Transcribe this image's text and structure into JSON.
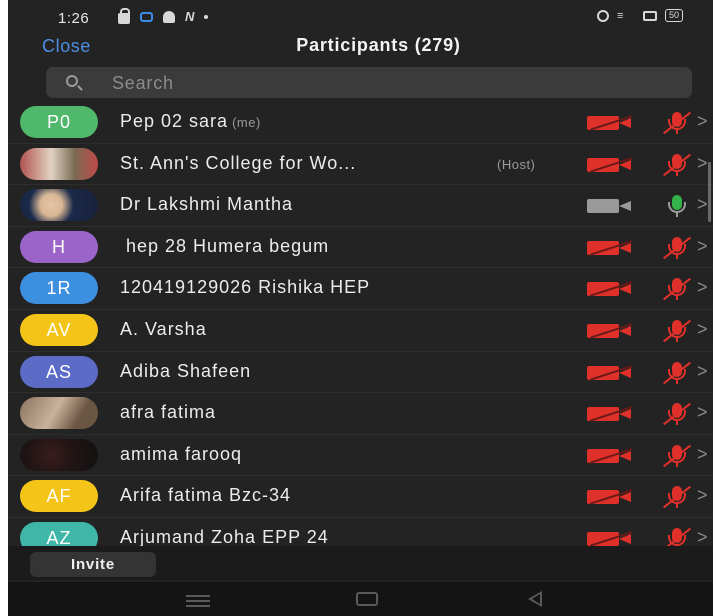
{
  "status_bar": {
    "time": "1:26",
    "battery": "50"
  },
  "header": {
    "close_label": "Close",
    "title": "Participants (279)"
  },
  "search": {
    "placeholder": "Search"
  },
  "participants": [
    {
      "avatar_text": "P0",
      "avatar_color": "#4fb86a",
      "name": "Pep 02 sara",
      "role": "(me)",
      "video_on": false,
      "audio_on": false
    },
    {
      "avatar_text": "",
      "avatar_color": "",
      "name": "St. Ann's College for Wo...",
      "role": "(Host)",
      "video_on": false,
      "audio_on": false
    },
    {
      "avatar_text": "",
      "avatar_color": "",
      "name": "Dr Lakshmi Mantha",
      "role": "",
      "video_on": true,
      "audio_on": true
    },
    {
      "avatar_text": "H",
      "avatar_color": "#9b64c8",
      "name": " hep 28 Humera begum",
      "role": "",
      "video_on": false,
      "audio_on": false
    },
    {
      "avatar_text": "1R",
      "avatar_color": "#3d8fe0",
      "name": "120419129026 Rishika HEP",
      "role": "",
      "video_on": false,
      "audio_on": false
    },
    {
      "avatar_text": "AV",
      "avatar_color": "#f5c418",
      "name": "A. Varsha",
      "role": "",
      "video_on": false,
      "audio_on": false
    },
    {
      "avatar_text": "AS",
      "avatar_color": "#5b6bc6",
      "name": "Adiba Shafeen",
      "role": "",
      "video_on": false,
      "audio_on": false
    },
    {
      "avatar_text": "",
      "avatar_color": "",
      "name": "afra fatima",
      "role": "",
      "video_on": false,
      "audio_on": false
    },
    {
      "avatar_text": "",
      "avatar_color": "",
      "name": "amima farooq",
      "role": "",
      "video_on": false,
      "audio_on": false
    },
    {
      "avatar_text": "AF",
      "avatar_color": "#f5c418",
      "name": "Arifa fatima Bzc-34",
      "role": "",
      "video_on": false,
      "audio_on": false
    },
    {
      "avatar_text": "AZ",
      "avatar_color": "#3fb7a8",
      "name": "Arjumand Zoha EPP 24",
      "role": "",
      "video_on": false,
      "audio_on": false
    }
  ],
  "footer": {
    "invite_label": "Invite"
  }
}
